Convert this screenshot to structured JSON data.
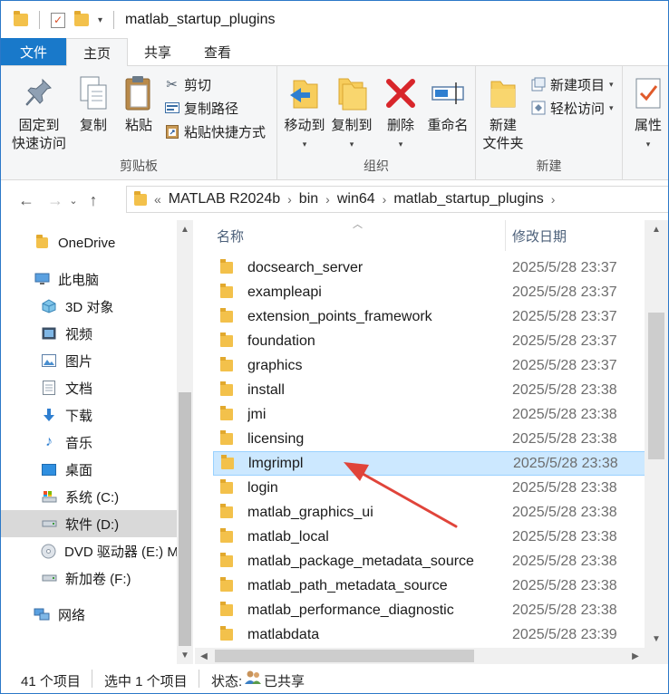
{
  "window": {
    "title": "matlab_startup_plugins"
  },
  "tabs": [
    {
      "label": "文件"
    },
    {
      "label": "主页"
    },
    {
      "label": "共享"
    },
    {
      "label": "查看"
    }
  ],
  "ribbon": {
    "clipboard": {
      "pin_line1": "固定到",
      "pin_line2": "快速访问",
      "copy": "复制",
      "paste": "粘贴",
      "cut": "剪切",
      "copy_path": "复制路径",
      "paste_shortcut": "粘贴快捷方式",
      "group_label": "剪贴板"
    },
    "organize": {
      "move_to": "移动到",
      "copy_to": "复制到",
      "delete": "删除",
      "rename": "重命名",
      "group_label": "组织"
    },
    "new": {
      "new_folder_line1": "新建",
      "new_folder_line2": "文件夹",
      "new_item": "新建项目",
      "easy_access": "轻松访问",
      "group_label": "新建"
    },
    "open": {
      "properties": "属性"
    }
  },
  "address": {
    "overflow": "«",
    "crumbs": [
      "MATLAB R2024b",
      "bin",
      "win64",
      "matlab_startup_plugins"
    ]
  },
  "nav": [
    {
      "label": "OneDrive",
      "icon": "onedrive-folder-icon"
    },
    {
      "label": "此电脑",
      "icon": "computer-icon"
    },
    {
      "label": "3D 对象",
      "icon": "3d-objects-icon"
    },
    {
      "label": "视频",
      "icon": "video-icon"
    },
    {
      "label": "图片",
      "icon": "pictures-icon"
    },
    {
      "label": "文档",
      "icon": "documents-icon"
    },
    {
      "label": "下载",
      "icon": "download-icon"
    },
    {
      "label": "音乐",
      "icon": "music-icon"
    },
    {
      "label": "桌面",
      "icon": "desktop-icon"
    },
    {
      "label": "系统 (C:)",
      "icon": "system-drive-icon"
    },
    {
      "label": "软件 (D:)",
      "icon": "drive-icon"
    },
    {
      "label": "DVD 驱动器 (E:) M",
      "icon": "dvd-icon"
    },
    {
      "label": "新加卷 (F:)",
      "icon": "drive-icon"
    },
    {
      "label": "网络",
      "icon": "network-icon"
    }
  ],
  "columns": {
    "name": "名称",
    "date": "修改日期"
  },
  "files": [
    {
      "name": "docsearch_server",
      "date": "2025/5/28 23:37"
    },
    {
      "name": "exampleapi",
      "date": "2025/5/28 23:37"
    },
    {
      "name": "extension_points_framework",
      "date": "2025/5/28 23:37"
    },
    {
      "name": "foundation",
      "date": "2025/5/28 23:37"
    },
    {
      "name": "graphics",
      "date": "2025/5/28 23:37"
    },
    {
      "name": "install",
      "date": "2025/5/28 23:38"
    },
    {
      "name": "jmi",
      "date": "2025/5/28 23:38"
    },
    {
      "name": "licensing",
      "date": "2025/5/28 23:38"
    },
    {
      "name": "lmgrimpl",
      "date": "2025/5/28 23:38",
      "selected": true
    },
    {
      "name": "login",
      "date": "2025/5/28 23:38"
    },
    {
      "name": "matlab_graphics_ui",
      "date": "2025/5/28 23:38"
    },
    {
      "name": "matlab_local",
      "date": "2025/5/28 23:38"
    },
    {
      "name": "matlab_package_metadata_source",
      "date": "2025/5/28 23:38"
    },
    {
      "name": "matlab_path_metadata_source",
      "date": "2025/5/28 23:38"
    },
    {
      "name": "matlab_performance_diagnostic",
      "date": "2025/5/28 23:38"
    },
    {
      "name": "matlabdata",
      "date": "2025/5/28 23:39"
    }
  ],
  "status": {
    "count": "41 个项目",
    "selected": "选中 1 个项目",
    "state_label": "状态:",
    "state_value": "已共享"
  },
  "colors": {
    "accent": "#1979ca",
    "selection": "#cce8ff",
    "annotation_arrow": "#e0443a"
  }
}
